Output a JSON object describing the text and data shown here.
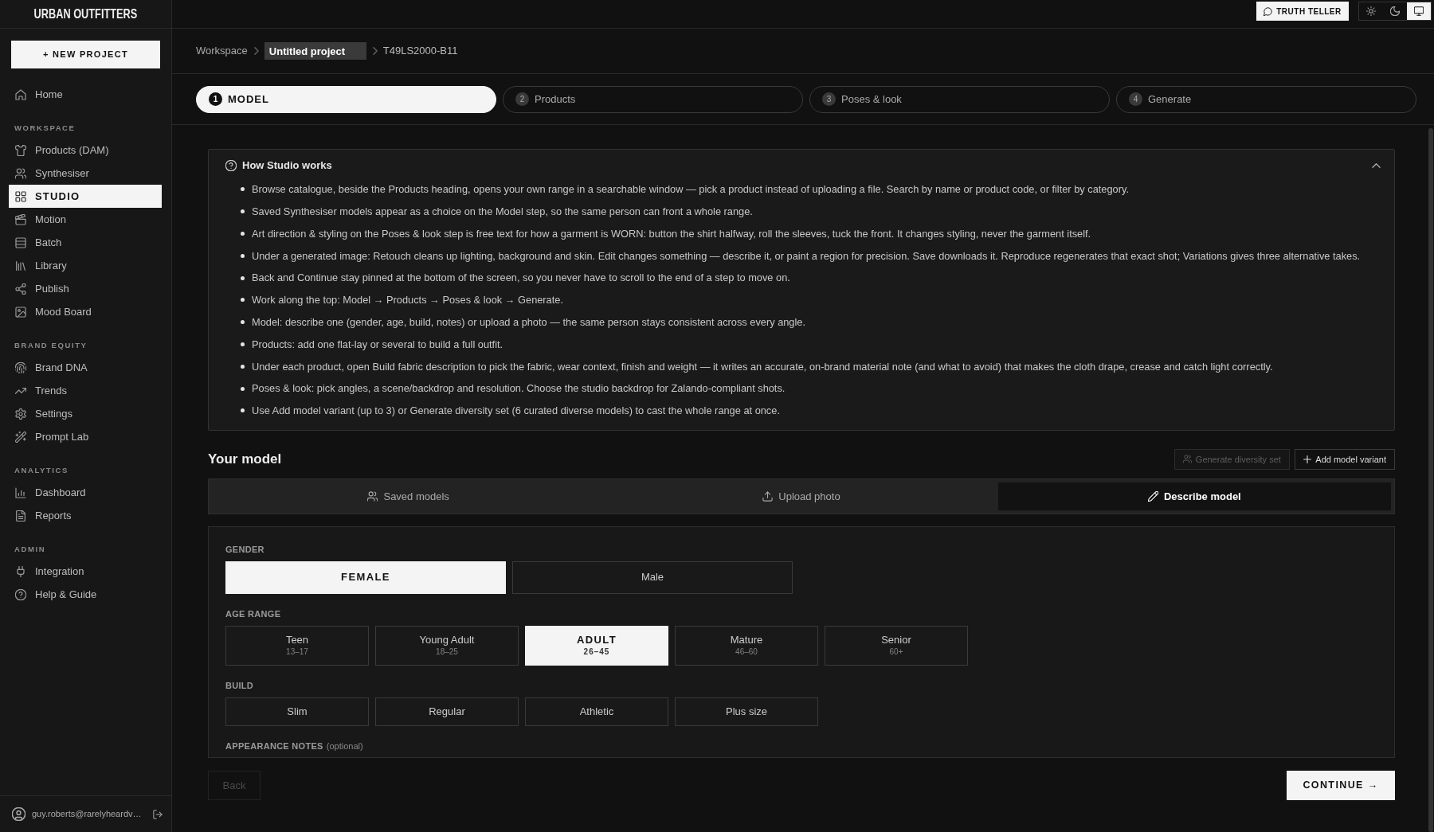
{
  "sidebar": {
    "logo": "URBAN OUTFITTERS",
    "new_project": "+ NEW PROJECT",
    "groups": [
      {
        "items": [
          {
            "label": "Home",
            "selected": false
          }
        ]
      },
      {
        "heading": "WORKSPACE",
        "items": [
          {
            "label": "Products (DAM)",
            "selected": false
          },
          {
            "label": "Synthesiser",
            "selected": false
          },
          {
            "label": "STUDIO",
            "selected": true
          },
          {
            "label": "Motion",
            "selected": false
          },
          {
            "label": "Batch",
            "selected": false
          },
          {
            "label": "Library",
            "selected": false
          },
          {
            "label": "Publish",
            "selected": false
          },
          {
            "label": "Mood Board",
            "selected": false
          }
        ]
      },
      {
        "heading": "BRAND EQUITY",
        "items": [
          {
            "label": "Brand DNA",
            "selected": false
          },
          {
            "label": "Trends",
            "selected": false
          },
          {
            "label": "Settings",
            "selected": false
          },
          {
            "label": "Prompt Lab",
            "selected": false
          }
        ]
      },
      {
        "heading": "ANALYTICS",
        "items": [
          {
            "label": "Dashboard",
            "selected": false
          },
          {
            "label": "Reports",
            "selected": false
          }
        ]
      },
      {
        "heading": "ADMIN",
        "items": [
          {
            "label": "Integration",
            "selected": false
          },
          {
            "label": "Help & Guide",
            "selected": false
          }
        ]
      }
    ],
    "user": {
      "email": "guy.roberts@rarelyheardv…"
    }
  },
  "topbar": {
    "truth_teller": "TRUTH TELLER",
    "theme_modes": [
      {
        "selected": false
      },
      {
        "selected": false
      },
      {
        "selected": true
      }
    ]
  },
  "breadcrumb": [
    {
      "kind": "link",
      "label": "Workspace"
    },
    {
      "kind": "field",
      "value": "Untitled project"
    },
    {
      "kind": "text",
      "label": "T49LS2000-B11"
    }
  ],
  "steps": [
    {
      "number": "1",
      "label": "MODEL",
      "selected": true
    },
    {
      "number": "2",
      "label": "Products",
      "selected": false
    },
    {
      "number": "3",
      "label": "Poses & look",
      "selected": false
    },
    {
      "number": "4",
      "label": "Generate",
      "selected": false
    }
  ],
  "help": {
    "title": "How Studio works",
    "expanded": true,
    "items": [
      "Browse catalogue, beside the Products heading, opens your own range in a searchable window — pick a product instead of uploading a file. Search by name or product code, or filter by category.",
      "Saved Synthesiser models appear as a choice on the Model step, so the same person can front a whole range.",
      "Art direction & styling on the Poses & look step is free text for how a garment is WORN: button the shirt halfway, roll the sleeves, tuck the front. It changes styling, never the garment itself.",
      "Under a generated image: Retouch cleans up lighting, background and skin. Edit changes something — describe it, or paint a region for precision. Save downloads it. Reproduce regenerates that exact shot; Variations gives three alternative takes.",
      "Back and Continue stay pinned at the bottom of the screen, so you never have to scroll to the end of a step to move on.",
      "Work along the top: Model → Products → Poses & look → Generate.",
      "Model: describe one (gender, age, build, notes) or upload a photo — the same person stays consistent across every angle.",
      "Products: add one flat-lay or several to build a full outfit.",
      "Under each product, open Build fabric description to pick the fabric, wear context, finish and weight — it writes an accurate, on-brand material note (and what to avoid) that makes the cloth drape, crease and catch light correctly.",
      "Poses & look: pick angles, a scene/backdrop and resolution. Choose the studio backdrop for Zalando-compliant shots.",
      "Use Add model variant (up to 3) or Generate diversity set (6 curated diverse models) to cast the whole range at once."
    ]
  },
  "model": {
    "title": "Your model",
    "actions": [
      {
        "kind": "diversity",
        "label": "Generate diversity set",
        "disabled": true
      },
      {
        "kind": "variant",
        "label": "Add model variant",
        "disabled": false
      }
    ],
    "tabs": [
      {
        "label": "Saved models",
        "selected": false
      },
      {
        "label": "Upload photo",
        "selected": false
      },
      {
        "label": "Describe model",
        "selected": true
      }
    ],
    "fields": [
      {
        "label": "GENDER",
        "kind": "wide",
        "options": [
          {
            "label": "FEMALE",
            "selected": true
          },
          {
            "label": "Male",
            "selected": false
          }
        ]
      },
      {
        "label": "AGE RANGE",
        "kind": "tile",
        "options": [
          {
            "label": "Teen",
            "sub": "13–17",
            "selected": false
          },
          {
            "label": "Young Adult",
            "sub": "18–25",
            "selected": false
          },
          {
            "label": "ADULT",
            "sub": "26–45",
            "selected": true
          },
          {
            "label": "Mature",
            "sub": "46–60",
            "selected": false
          },
          {
            "label": "Senior",
            "sub": "60+",
            "selected": false
          }
        ]
      },
      {
        "label": "BUILD",
        "kind": "tile",
        "options": [
          {
            "label": "Slim",
            "selected": false
          },
          {
            "label": "Regular",
            "selected": false
          },
          {
            "label": "Athletic",
            "selected": false
          },
          {
            "label": "Plus size",
            "selected": false
          }
        ]
      }
    ],
    "notes": {
      "label": "APPEARANCE NOTES",
      "hint": "(optional)"
    }
  },
  "footer": {
    "back": {
      "label": "Back",
      "disabled": true
    },
    "continue": {
      "label": "CONTINUE →"
    }
  }
}
